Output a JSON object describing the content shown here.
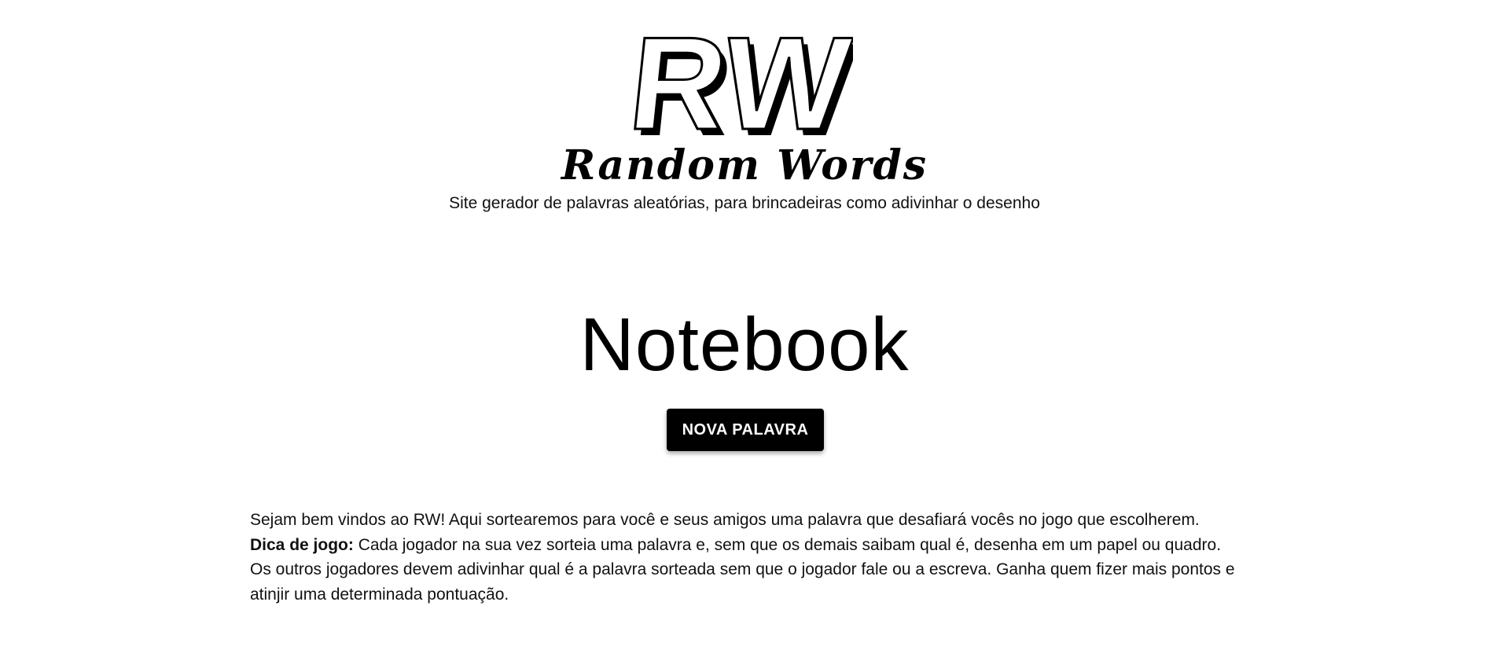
{
  "header": {
    "logo_letters": "RW",
    "logo_subtitle": "Random Words",
    "tagline": "Site gerador de palavras aleatórias, para brincadeiras como adivinhar o desenho"
  },
  "main": {
    "current_word": "Notebook",
    "new_word_button": "NOVA PALAVRA"
  },
  "intro": {
    "welcome": "Sejam bem vindos ao RW! Aqui sortearemos para você e seus amigos uma palavra que desafiará vocês no jogo que escolherem.",
    "tip_label": "Dica de jogo:",
    "tip_text": " Cada jogador na sua vez sorteia uma palavra e, sem que os demais saibam qual é, desenha em um papel ou quadro. Os outros jogadores devem adivinhar qual é a palavra sorteada sem que o jogador fale ou a escreva. Ganha quem fizer mais pontos e atinjir uma determinada pontuação."
  },
  "colors": {
    "text": "#111111",
    "button_bg": "#000000",
    "button_text": "#ffffff",
    "background": "#ffffff"
  }
}
